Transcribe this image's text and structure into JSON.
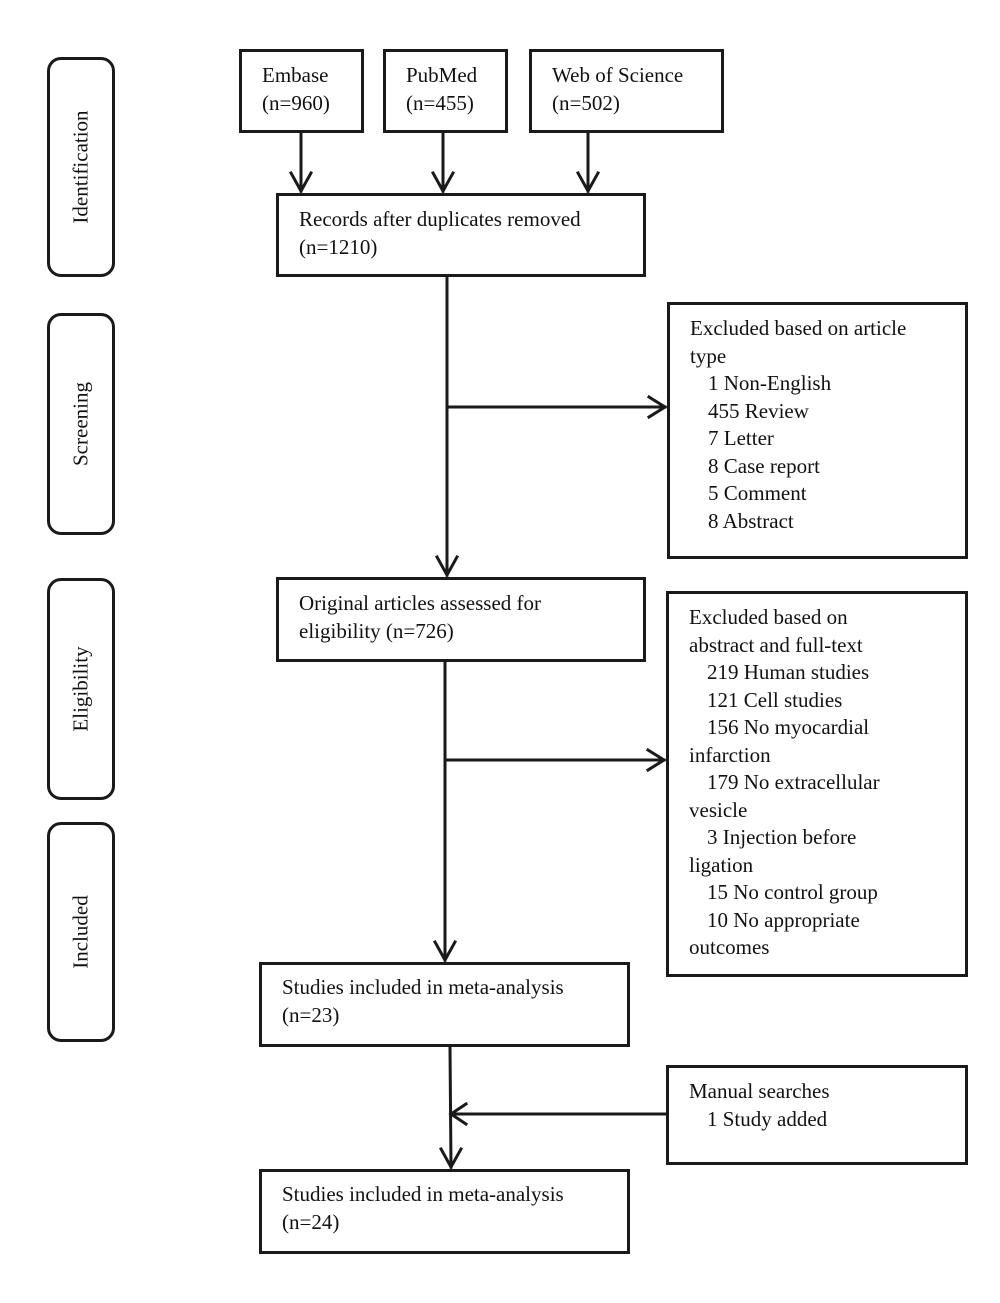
{
  "stages": [
    {
      "id": "identification",
      "label": "Identification"
    },
    {
      "id": "screening",
      "label": "Screening"
    },
    {
      "id": "eligibility",
      "label": "Eligibility"
    },
    {
      "id": "included",
      "label": "Included"
    }
  ],
  "sources": [
    {
      "name": "Embase",
      "count": "(n=960)"
    },
    {
      "name": "PubMed",
      "count": "(n=455)"
    },
    {
      "name": "Web of Science",
      "count": "(n=502)"
    }
  ],
  "records_after_duplicates": {
    "title": "Records after duplicates removed",
    "count": "(n=1210)"
  },
  "excluded_article_type": {
    "title_line1": "Excluded based on article",
    "title_line2": "type",
    "items": [
      "1 Non-English",
      "455 Review",
      "7 Letter",
      "8 Case report",
      "5 Comment",
      "8 Abstract"
    ]
  },
  "assessed_for_eligibility": {
    "line1": "Original articles assessed for",
    "line2": "eligibility (n=726)"
  },
  "excluded_fulltext": {
    "title_line1": "Excluded based on",
    "title_line2": "abstract and full-text",
    "lines": [
      {
        "text": "219 Human studies",
        "indent": true
      },
      {
        "text": "121 Cell studies",
        "indent": true
      },
      {
        "text": "156 No myocardial",
        "indent": true
      },
      {
        "text": "infarction",
        "indent": false
      },
      {
        "text": "179 No extracellular",
        "indent": true
      },
      {
        "text": "vesicle",
        "indent": false
      },
      {
        "text": "3 Injection before",
        "indent": true
      },
      {
        "text": "ligation",
        "indent": false
      },
      {
        "text": "15 No control group",
        "indent": true
      },
      {
        "text": "10 No appropriate",
        "indent": true
      },
      {
        "text": "outcomes",
        "indent": false
      }
    ]
  },
  "included_initial": {
    "title": "Studies included in meta-analysis",
    "count": "(n=23)"
  },
  "manual_searches": {
    "title": "Manual searches",
    "item": "1 Study added"
  },
  "included_final": {
    "title": "Studies included in meta-analysis",
    "count": "(n=24)"
  }
}
